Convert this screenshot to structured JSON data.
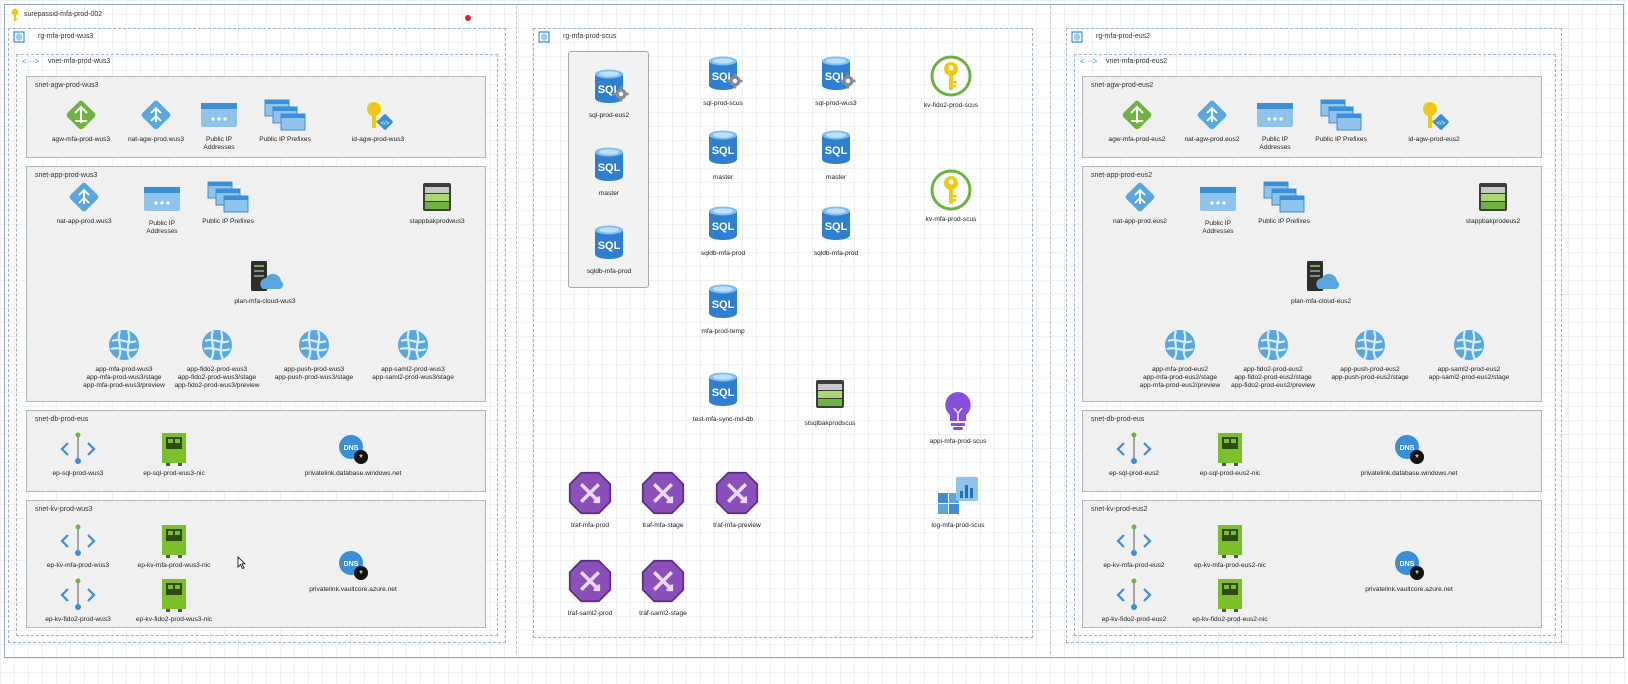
{
  "subscription": {
    "name": "surepassid-mfa-prod-002"
  },
  "resource_groups": {
    "wus3": {
      "title": "rg-mfa-prod-wus3",
      "vnet": "vnet-mfa-prod-wus3",
      "snet_agw": {
        "title": "snet-agw-prod-wus3",
        "items": [
          "agw-mfa-prod-wus3",
          "nat-agw-prod.wus3",
          "Public IP\nAddresses",
          "Public IP Prefixes",
          "id-agw-prod-wus3"
        ]
      },
      "snet_app": {
        "title": "snet-app-prod-wus3",
        "nat": "nat-app-prod.wus3",
        "pip": "Public IP\nAddresses",
        "pipp": "Public IP Prefixes",
        "storage": "stappbakprodwus3",
        "plan": "plan-mfa-cloud-wus3",
        "apps": [
          "app-mfa-prod-wus3\napp-mfa-prod-wus3/stage\napp-mfa-prod-wus3/preview",
          "app-fido2-prod-wus3\napp-fido2-prod-wus3/stage\napp-fido2-prod-wus3/preview",
          "app-push-prod-wus3\napp-push-prod-wus3/stage",
          "app-saml2-prod-wus3\napp-saml2-prod-wus3/stage"
        ]
      },
      "snet_db": {
        "title": "snet-db-prod-eus",
        "ep": "ep-sql-prod-wus3",
        "nic": "ep-sql-prod-wus3-nic",
        "dns": "privatelink.database.windows.net"
      },
      "snet_kv": {
        "title": "snet-kv-prod-wus3",
        "ep1": "ep-kv-mfa-prod-wus3",
        "nic1": "ep-kv-mfa-prod-wus3-nic",
        "ep2": "ep-kv-fido2-prod-wus3",
        "nic2": "ep-kv-fido2-prod-wus3-nic",
        "dns": "privatelink.vaultcore.azure.net"
      }
    },
    "scus": {
      "title": "rg-mfa-prod-scus",
      "sql_group": [
        "sql-prod-eus2",
        "master",
        "sqldb-mfa-prod"
      ],
      "sql_col1": [
        "sql-prod-scus",
        "master",
        "sqldb-mfa-prod",
        "mfa-prod-temp",
        "test-mfa-sync-md-db"
      ],
      "sql_col2": [
        "sql-prod-wus3",
        "master",
        "sqldb-mfa-prod"
      ],
      "storage": "stsqlbakprodscus",
      "kv1": "kv-fido2-prod-scus",
      "kv2": "kv-mfa-prod-scus",
      "appi": "appi-mfa-prod-scus",
      "log": "log-mfa-prod-scus",
      "traffic": [
        "traf-mfa-prod",
        "traf-mfa-stage",
        "traf-mfa-preview",
        "traf-saml2-prod",
        "traf-saml2-stage"
      ]
    },
    "eus2": {
      "title": "rg-mfa-prod-eus2",
      "vnet": "vnet-mfa-prod-eus2",
      "snet_agw": {
        "title": "snet-agw-prod-eus2",
        "items": [
          "agw-mfa-prod-eus2",
          "nat-agw-prod.eus2",
          "Public IP\nAddresses",
          "Public IP Prefixes",
          "id-agw-prod-eus2"
        ]
      },
      "snet_app": {
        "title": "snet-app-prod-eus2",
        "nat": "nat-app-prod.eus2",
        "pip": "Public IP\nAddresses",
        "pipp": "Public IP Prefixes",
        "storage": "stappbakprodeus2",
        "plan": "plan-mfa-cloud-eus2",
        "apps": [
          "app-mfa-prod-eus2\napp-mfa-prod-eus2/stage\napp-mfa-prod-eus2/preview",
          "app-fido2-prod-eus2\napp-fido2-prod-eus2/stage\napp-fido2-prod-eus2/preview",
          "app-push-prod-eus2\napp-push-prod-eus2/stage",
          "app-saml2-prod-eus2\napp-saml2-prod-eus2/stage"
        ]
      },
      "snet_db": {
        "title": "snet-db-prod-eus",
        "ep": "ep-sql-prod-eus2",
        "nic": "ep-sql-prod-eus2-nic",
        "dns": "privatelink.database.windows.net"
      },
      "snet_kv": {
        "title": "snet-kv-prod-eus2",
        "ep1": "ep-kv-mfa-prod-eus2",
        "nic1": "ep-kv-mfa-prod-eus2-nic",
        "ep2": "ep-kv-fido2-prod-eus2",
        "nic2": "ep-kv-fido2-prod-eus2-nic",
        "dns": "privatelink.vaultcore.azure.net"
      }
    }
  },
  "colors": {
    "azure_blue": "#3a8fd6",
    "sql_blue": "#2f7fd0",
    "green": "#6cb33f",
    "key_yellow": "#f2c811",
    "traffic_purple": "#8a4fb8",
    "nic_green": "#7bbf2a"
  }
}
